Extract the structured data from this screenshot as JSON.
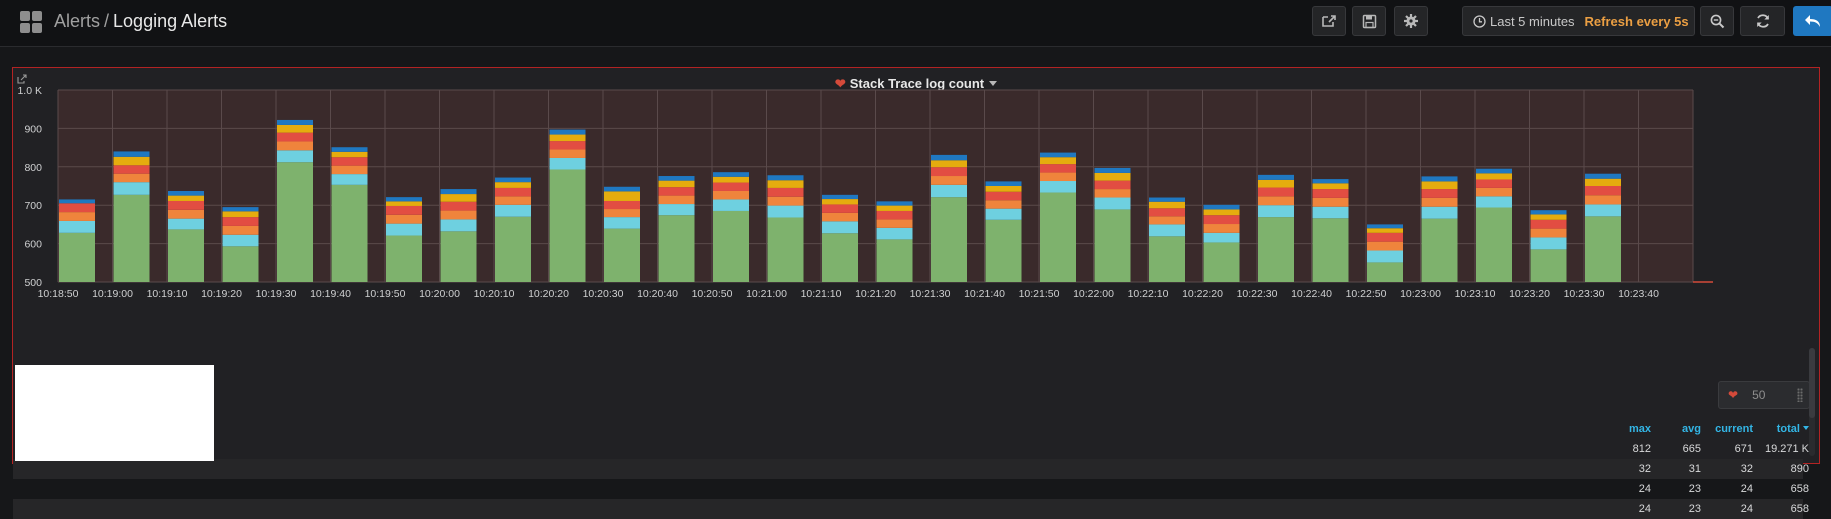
{
  "navbar": {
    "folder": "Alerts",
    "separator": "/",
    "dashboard_title": "Logging Alerts",
    "time_range": "Last 5 minutes",
    "refresh": "Refresh every 5s"
  },
  "panel": {
    "title": "Stack Trace log count",
    "alert_threshold": "50"
  },
  "chart_data": {
    "type": "bar",
    "stacked": true,
    "categories": [
      "10:18:50",
      "10:19:00",
      "10:19:10",
      "10:19:20",
      "10:19:30",
      "10:19:40",
      "10:19:50",
      "10:20:00",
      "10:20:10",
      "10:20:20",
      "10:20:30",
      "10:20:40",
      "10:20:50",
      "10:21:00",
      "10:21:10",
      "10:21:20",
      "10:21:30",
      "10:21:40",
      "10:21:50",
      "10:22:00",
      "10:22:10",
      "10:22:20",
      "10:22:30",
      "10:22:40",
      "10:22:50",
      "10:23:00",
      "10:23:10",
      "10:23:20",
      "10:23:30",
      "10:23:40"
    ],
    "series": [
      {
        "color": "#7eb26d",
        "values": [
          628,
          727,
          637,
          593,
          812,
          753,
          621,
          632,
          670,
          793,
          639,
          674,
          685,
          668,
          627,
          611,
          721,
          662,
          733,
          689,
          619,
          603,
          669,
          666,
          551,
          665,
          694,
          585,
          671,
          null
        ]
      },
      {
        "color": "#6ed0e0",
        "values": [
          31,
          33,
          28,
          30,
          31,
          28,
          31,
          31,
          31,
          30,
          30,
          29,
          30,
          31,
          31,
          30,
          32,
          29,
          30,
          31,
          31,
          25,
          31,
          30,
          31,
          31,
          29,
          31,
          31,
          null
        ]
      },
      {
        "color": "#ef843c",
        "values": [
          23,
          22,
          23,
          23,
          23,
          22,
          23,
          23,
          22,
          22,
          21,
          22,
          22,
          23,
          22,
          22,
          23,
          22,
          22,
          22,
          21,
          23,
          23,
          23,
          23,
          23,
          22,
          23,
          24,
          null
        ]
      },
      {
        "color": "#e24d42",
        "values": [
          23,
          22,
          23,
          23,
          23,
          22,
          23,
          23,
          22,
          22,
          21,
          22,
          22,
          23,
          22,
          22,
          23,
          22,
          22,
          22,
          21,
          23,
          23,
          23,
          23,
          23,
          22,
          23,
          24,
          null
        ]
      },
      {
        "color": "#e5ac0e",
        "values": [
          0,
          22,
          14,
          15,
          20,
          14,
          12,
          20,
          15,
          17,
          25,
          17,
          15,
          20,
          14,
          14,
          18,
          15,
          18,
          20,
          17,
          15,
          20,
          15,
          12,
          20,
          16,
          14,
          19,
          null
        ]
      },
      {
        "color": "#1f78c1",
        "values": [
          10,
          14,
          12,
          11,
          13,
          12,
          11,
          13,
          12,
          13,
          12,
          12,
          12,
          13,
          11,
          11,
          14,
          12,
          12,
          13,
          11,
          12,
          13,
          11,
          10,
          13,
          12,
          11,
          13,
          null
        ]
      }
    ],
    "ylim": [
      500,
      1000
    ],
    "yticks": [
      "500",
      "600",
      "700",
      "800",
      "900",
      "1.0 K"
    ],
    "grid": true,
    "threshold": 500
  },
  "legend": {
    "headers": {
      "max": "max",
      "avg": "avg",
      "current": "current",
      "total": "total"
    },
    "rows": [
      {
        "max": "812",
        "avg": "665",
        "current": "671",
        "total": "19.271 K"
      },
      {
        "max": "32",
        "avg": "31",
        "current": "32",
        "total": "890"
      },
      {
        "max": "24",
        "avg": "23",
        "current": "24",
        "total": "658"
      },
      {
        "max": "24",
        "avg": "23",
        "current": "24",
        "total": "658"
      }
    ]
  }
}
